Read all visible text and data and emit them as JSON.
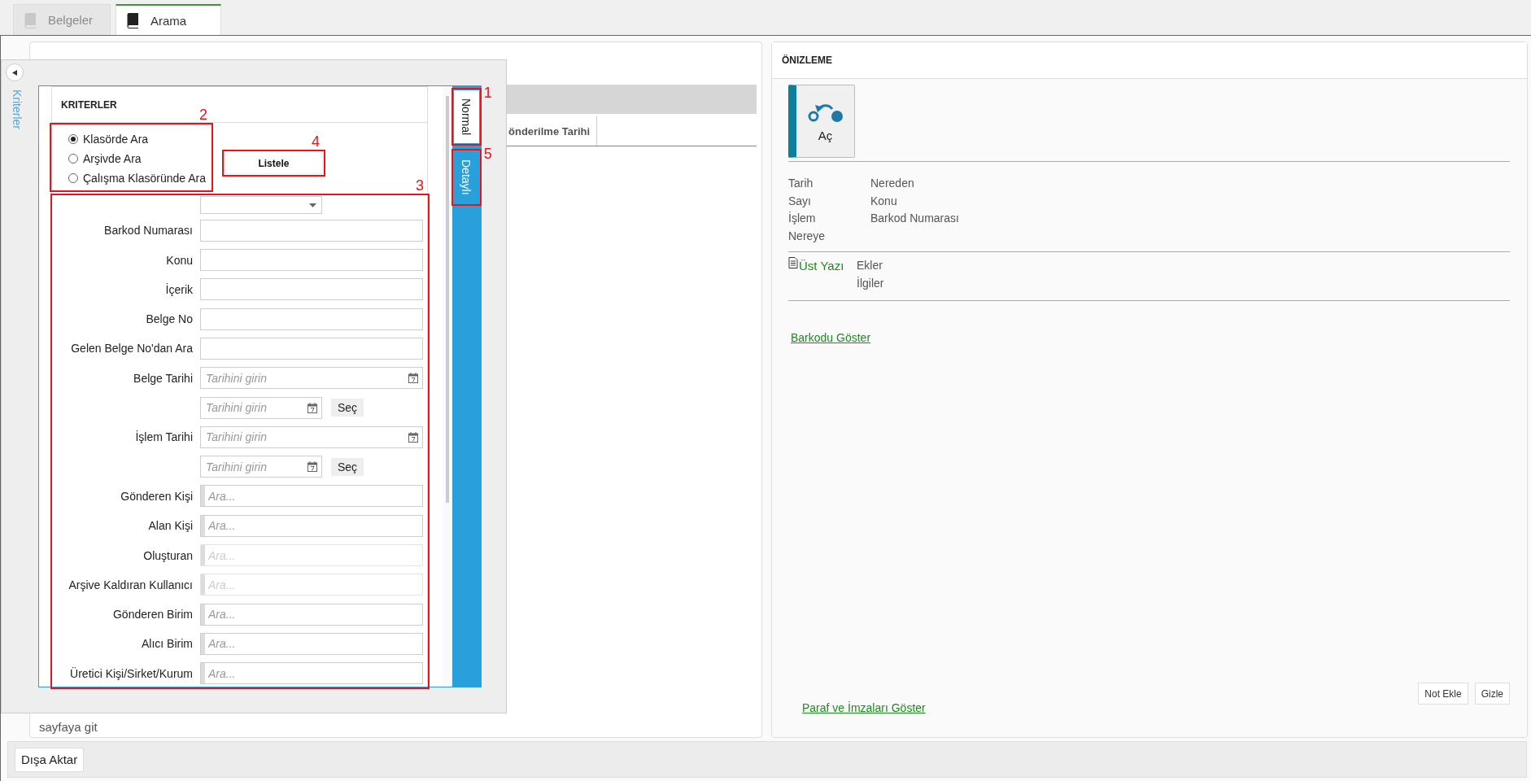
{
  "tabs": [
    {
      "label": "Belgeler",
      "selected": false
    },
    {
      "label": "Arama",
      "selected": true
    }
  ],
  "documents_panel": {
    "grid_columns": [
      "önderilme Tarihi"
    ],
    "pager_text": "sayfaya git"
  },
  "criteria_flyout": {
    "side_label": "Kriterler",
    "title": "KRITERLER",
    "search_scope": {
      "annotation": {
        "number": "2"
      },
      "options": [
        {
          "label": "Klasörde Ara",
          "selected": true
        },
        {
          "label": "Arşivde Ara",
          "selected": false
        },
        {
          "label": "Çalışma Klasöründe Ara",
          "selected": false
        }
      ]
    },
    "list_button": {
      "label": "Listele",
      "annotation": {
        "number": "4"
      }
    },
    "fields_annotation": {
      "number": "3"
    },
    "fields": [
      {
        "kind": "select",
        "disabled": false
      },
      {
        "kind": "text",
        "label": "Barkod Numarası",
        "disabled": false
      },
      {
        "kind": "text",
        "label": "Konu",
        "disabled": false
      },
      {
        "kind": "text",
        "label": "İçerik",
        "disabled": false
      },
      {
        "kind": "text",
        "label": "Belge No",
        "disabled": false
      },
      {
        "kind": "text",
        "label": "Gelen Belge No'dan Ara",
        "disabled": false
      },
      {
        "kind": "date",
        "label": "Belge Tarihi",
        "placeholder": "Tarihini girin",
        "disabled": false
      },
      {
        "kind": "date_end",
        "placeholder": "Tarihini girin",
        "button": "Seç",
        "disabled": false
      },
      {
        "kind": "date",
        "label": "İşlem Tarihi",
        "placeholder": "Tarihini girin",
        "disabled": false
      },
      {
        "kind": "date_end",
        "placeholder": "Tarihini girin",
        "button": "Seç",
        "disabled": false
      },
      {
        "kind": "lookup",
        "label": "Gönderen Kişi",
        "placeholder": "Ara...",
        "disabled": false
      },
      {
        "kind": "lookup",
        "label": "Alan Kişi",
        "placeholder": "Ara...",
        "disabled": false
      },
      {
        "kind": "lookup",
        "label": "Oluşturan",
        "placeholder": "Ara...",
        "disabled": true
      },
      {
        "kind": "lookup",
        "label": "Arşive Kaldıran Kullanıcı",
        "placeholder": "Ara...",
        "disabled": true
      },
      {
        "kind": "lookup",
        "label": "Gönderen Birim",
        "placeholder": "Ara...",
        "disabled": false
      },
      {
        "kind": "lookup",
        "label": "Alıcı Birim",
        "placeholder": "Ara...",
        "disabled": false
      },
      {
        "kind": "lookup",
        "label": "Üretici Kişi/Sirket/Kurum",
        "placeholder": "Ara...",
        "disabled": false
      }
    ],
    "mode_tabs": [
      {
        "label": "Normal",
        "selected": true,
        "annotation": {
          "number": "1"
        }
      },
      {
        "label": "Detaylı",
        "selected": false,
        "annotation": {
          "number": "5"
        }
      }
    ]
  },
  "preview": {
    "title": "ÖNIZLEME",
    "open_button": "Aç",
    "info_columns": [
      [
        "Tarih",
        "Sayı",
        "İşlem",
        "Nereye"
      ],
      [
        "Nereden",
        "Konu",
        "Barkod Numarası"
      ]
    ],
    "main_document": "Üst Yazı",
    "attachments": [
      "Ekler",
      "İlgiler"
    ],
    "barcode_link": "Barkodu Göster",
    "signatures_link": "Paraf ve İmzaları Göster",
    "buttons": [
      "Not Ekle",
      "Gizle"
    ]
  },
  "export_button": "Dışa Aktar"
}
